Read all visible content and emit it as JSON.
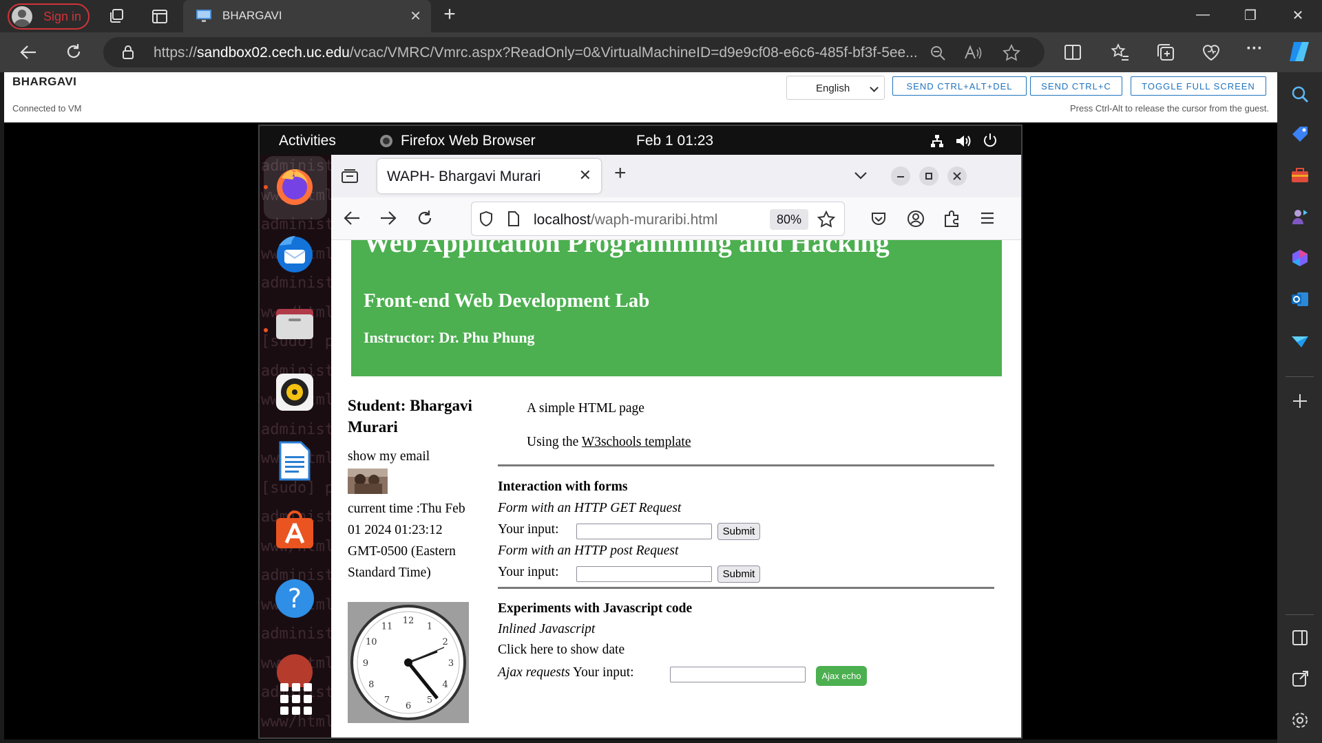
{
  "edge": {
    "signin_label": "Sign in",
    "tab_title": "BHARGAVI",
    "tab_close": "✕",
    "new_tab": "+",
    "window_controls": {
      "minimize": "—",
      "restore": "❐",
      "close": "✕"
    },
    "url_prefix": "https://",
    "url_host": "sandbox02.cech.uc.edu",
    "url_path": "/vcac/VMRC/Vmrc.aspx?ReadOnly=0&VirtualMachineID=d9e9cf08-e6c6-485f-bf3f-5ee...",
    "more_label": "···"
  },
  "vmrc": {
    "title": "BHARGAVI",
    "status": "Connected to VM",
    "language": "English",
    "btn_ctrl_alt_del": "SEND CTRL+ALT+DEL",
    "btn_ctrl_c": "SEND CTRL+C",
    "btn_fullscreen": "TOGGLE FULL SCREEN",
    "hint": "Press Ctrl-Alt to release the cursor from the guest."
  },
  "gnome": {
    "activities": "Activities",
    "app_name": "Firefox Web Browser",
    "clock": "Feb 1  01:23"
  },
  "dock": {
    "background_lines": [
      "administ",
      "www/html",
      "administ",
      "www/html",
      "administ",
      "www/html",
      "[sudo] p",
      "administ",
      "www/html",
      "administ",
      "www/html",
      "[sudo] p",
      "administ",
      "www/html",
      "administ",
      "www/html",
      "administ",
      "www/html",
      "administ",
      "www/html",
      "administ"
    ]
  },
  "firefox": {
    "tab_title": "WAPH- Bhargavi Murari",
    "tab_close": "✕",
    "new_tab": "+",
    "url_host": "localhost",
    "url_path": "/waph-muraribi.html",
    "zoom": "80%"
  },
  "page": {
    "h1": "Web Application Programming and Hacking",
    "h2": "Front-end Web Development Lab",
    "h3": "Instructor: Dr. Phu Phung",
    "student_line1": "Student: Bhargavi",
    "student_line2": "Murari",
    "show_email": "show my email",
    "time_lines": [
      "current time :Thu Feb",
      "01 2024 01:23:12",
      "GMT-0500 (Eastern",
      "Standard Time)"
    ],
    "intro": "A simple HTML page",
    "using_prefix": "Using the ",
    "w3_link": "W3schools template",
    "forms_title": "Interaction with forms",
    "get_title": "Form with an HTTP GET Request",
    "post_title": "Form with an HTTP post Request",
    "your_input": "Your input:",
    "submit": "Submit",
    "js_title": "Experiments with Javascript code",
    "inlined": "Inlined Javascript",
    "click_date": "Click here to show date",
    "ajax_label": "Ajax requests",
    "ajax_input": " Your input:",
    "ajax_button": "Ajax echo",
    "clock_numbers": [
      "12",
      "1",
      "2",
      "3",
      "4",
      "5",
      "6",
      "7",
      "8",
      "9",
      "10",
      "11"
    ]
  },
  "colors": {
    "header_green": "#4caf50",
    "signin_red": "#d13438",
    "vmrc_blue": "#1e73be",
    "ubuntu_orange": "#e95420"
  }
}
